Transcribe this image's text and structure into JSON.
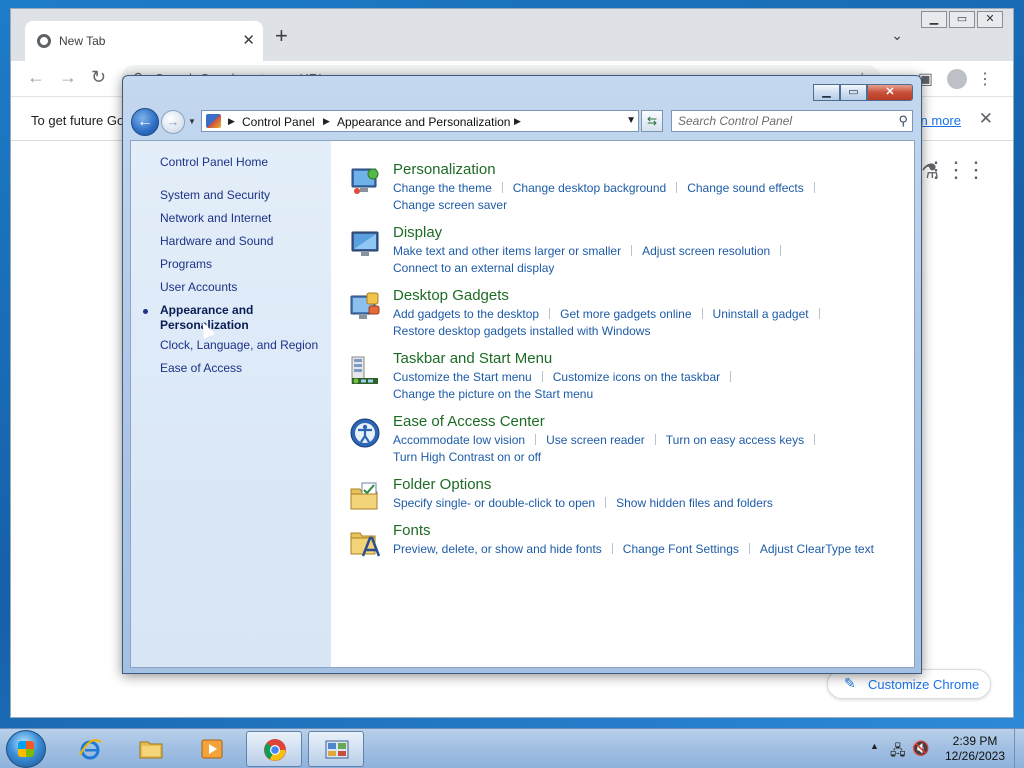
{
  "chrome": {
    "tab_title": "New Tab",
    "omnibox_placeholder": "Search Google or type a URL",
    "infobar_message": "To get future Go",
    "infobar_link": "n more",
    "customize_label": "Customize Chrome"
  },
  "window": {
    "breadcrumb": [
      "Control Panel",
      "Appearance and Personalization"
    ],
    "search_placeholder": "Search Control Panel"
  },
  "sidebar": {
    "home": "Control Panel Home",
    "items": [
      "System and Security",
      "Network and Internet",
      "Hardware and Sound",
      "Programs",
      "User Accounts",
      "Appearance and Personalization",
      "Clock, Language, and Region",
      "Ease of Access"
    ],
    "active_index": 5
  },
  "categories": [
    {
      "title": "Personalization",
      "icon": "personalization-icon",
      "links": [
        "Change the theme",
        "Change desktop background",
        "Change sound effects",
        "Change screen saver"
      ]
    },
    {
      "title": "Display",
      "icon": "display-icon",
      "links": [
        "Make text and other items larger or smaller",
        "Adjust screen resolution",
        "Connect to an external display"
      ]
    },
    {
      "title": "Desktop Gadgets",
      "icon": "gadgets-icon",
      "links": [
        "Add gadgets to the desktop",
        "Get more gadgets online",
        "Uninstall a gadget",
        "Restore desktop gadgets installed with Windows"
      ]
    },
    {
      "title": "Taskbar and Start Menu",
      "icon": "taskbar-icon",
      "links": [
        "Customize the Start menu",
        "Customize icons on the taskbar",
        "Change the picture on the Start menu"
      ]
    },
    {
      "title": "Ease of Access Center",
      "icon": "ease-of-access-icon",
      "links": [
        "Accommodate low vision",
        "Use screen reader",
        "Turn on easy access keys",
        "Turn High Contrast on or off"
      ]
    },
    {
      "title": "Folder Options",
      "icon": "folder-options-icon",
      "links": [
        "Specify single- or double-click to open",
        "Show hidden files and folders"
      ]
    },
    {
      "title": "Fonts",
      "icon": "fonts-icon",
      "links": [
        "Preview, delete, or show and hide fonts",
        "Change Font Settings",
        "Adjust ClearType text"
      ]
    }
  ],
  "taskbar": {
    "time": "2:39 PM",
    "date": "12/26/2023"
  }
}
